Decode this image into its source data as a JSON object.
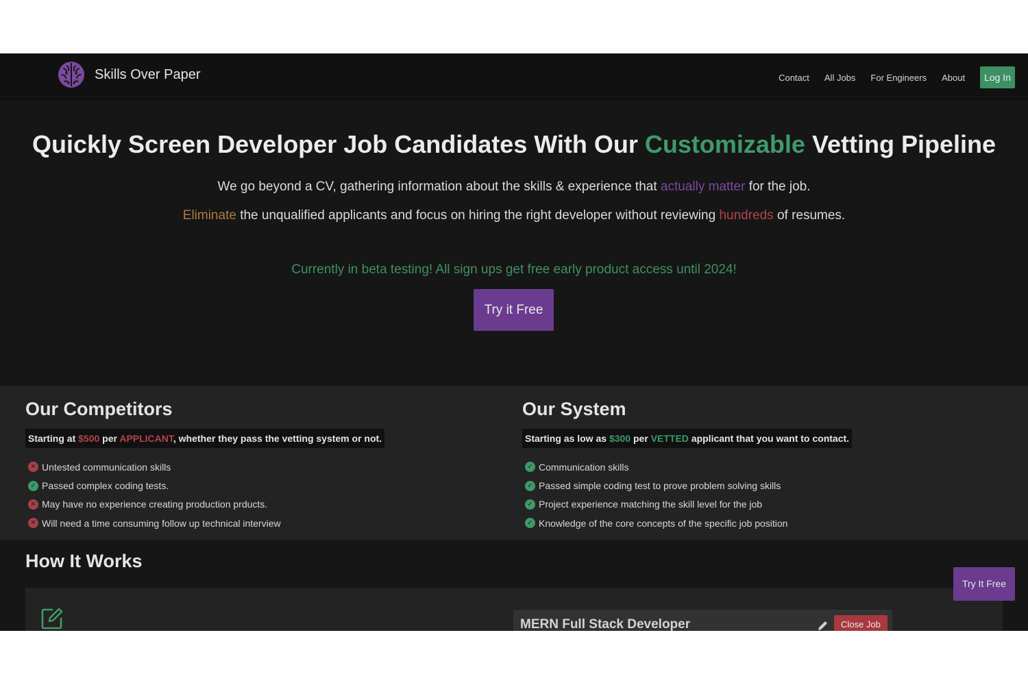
{
  "brand": {
    "name": "Skills Over Paper",
    "logo_icon": "brain-icon"
  },
  "nav": {
    "links": [
      "Contact",
      "All Jobs",
      "For Engineers",
      "About"
    ],
    "login_label": "Log In"
  },
  "hero": {
    "title_part1": "Quickly Screen Developer Job Candidates With Our ",
    "title_highlight": "Customizable",
    "title_part2": " Vetting Pipeline",
    "line1_part1": "We go beyond a CV, gathering information about the skills & experience that ",
    "line1_highlight": "actually matter",
    "line1_part2": " for the job.",
    "line2_highlight1": "Eliminate",
    "line2_part1": " the unqualified applicants and focus on hiring the right developer without reviewing ",
    "line2_highlight2": "hundreds",
    "line2_part2": " of resumes.",
    "beta_text": "Currently in beta testing! All sign ups get free early product access until 2024!",
    "cta_label": "Try it Free"
  },
  "competitors": {
    "title": "Our Competitors",
    "price_part1": "Starting at ",
    "price_amount": "$500",
    "price_part2": " per ",
    "price_unit": "APPLICANT",
    "price_part3": ", whether they pass the vetting system or not.",
    "items": [
      {
        "text": "Untested communication skills",
        "status": "cross"
      },
      {
        "text": "Passed complex coding tests.",
        "status": "check"
      },
      {
        "text": "May have no experience creating production prducts.",
        "status": "cross"
      },
      {
        "text": "Will need a time consuming follow up technical interview",
        "status": "cross"
      }
    ]
  },
  "system": {
    "title": "Our System",
    "price_part1": "Starting as low as ",
    "price_amount": "$300",
    "price_part2": " per ",
    "price_unit": "VETTED",
    "price_part3": " applicant that you want to contact.",
    "items": [
      {
        "text": "Communication skills",
        "status": "check"
      },
      {
        "text": "Passed simple coding test to prove problem solving skills",
        "status": "check"
      },
      {
        "text": "Project experience matching the skill level for the job",
        "status": "check"
      },
      {
        "text": "Knowledge of the core concepts of the specific job position",
        "status": "check"
      }
    ]
  },
  "how": {
    "title": "How It Works",
    "job_title": "MERN Full Stack Developer",
    "close_job_label": "Close Job"
  },
  "floating_cta_label": "Try It Free",
  "colors": {
    "accent_green": "#3f9a69",
    "accent_purple": "#6a3b8f",
    "accent_red": "#b4434a",
    "accent_orange": "#b07a3e",
    "background": "#161616"
  }
}
